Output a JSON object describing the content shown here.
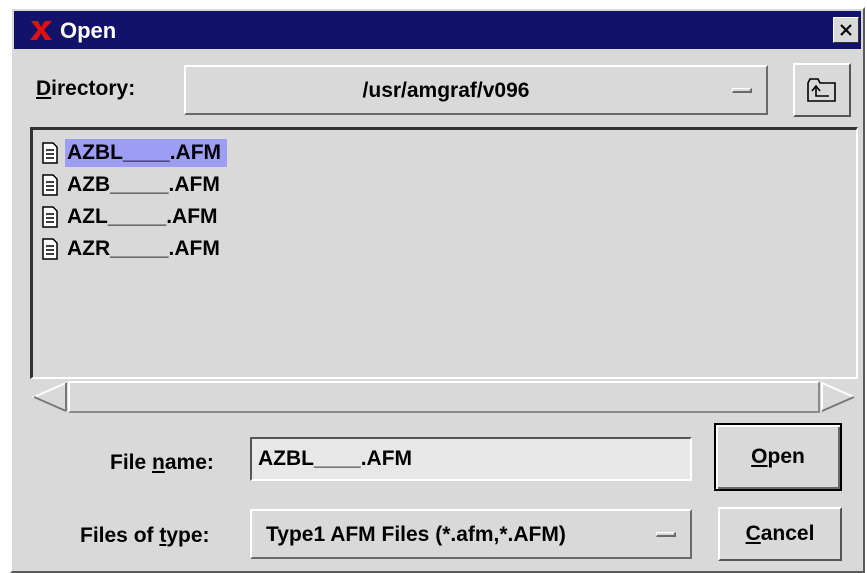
{
  "titlebar": {
    "title": "Open",
    "app_icon": "red-x-icon",
    "close_icon": "close-icon"
  },
  "directory": {
    "label_pre": "",
    "label_mnemonic": "D",
    "label_post": "irectory:",
    "value": "/usr/amgraf/v096",
    "up_icon": "folder-up-icon"
  },
  "files": [
    {
      "name": "AZBL____.AFM",
      "selected": true,
      "icon": "document-icon"
    },
    {
      "name": "AZB_____.AFM",
      "selected": false,
      "icon": "document-icon"
    },
    {
      "name": "AZL_____.AFM",
      "selected": false,
      "icon": "document-icon"
    },
    {
      "name": "AZR_____.AFM",
      "selected": false,
      "icon": "document-icon"
    }
  ],
  "file_name": {
    "label_pre": "File ",
    "label_mnemonic": "n",
    "label_post": "ame:",
    "value": "AZBL____.AFM"
  },
  "files_of_type": {
    "label_pre": "Files of ",
    "label_mnemonic": "t",
    "label_post": "ype:",
    "value": "Type1 AFM Files (*.afm,*.AFM)"
  },
  "buttons": {
    "open_mnemonic": "O",
    "open_rest": "pen",
    "cancel_mnemonic": "C",
    "cancel_rest": "ancel"
  },
  "colors": {
    "titlebar": "#12126a",
    "selection": "#9d9df5",
    "dialog_bg": "#d9d9d9",
    "x_icon": "#e01010"
  }
}
